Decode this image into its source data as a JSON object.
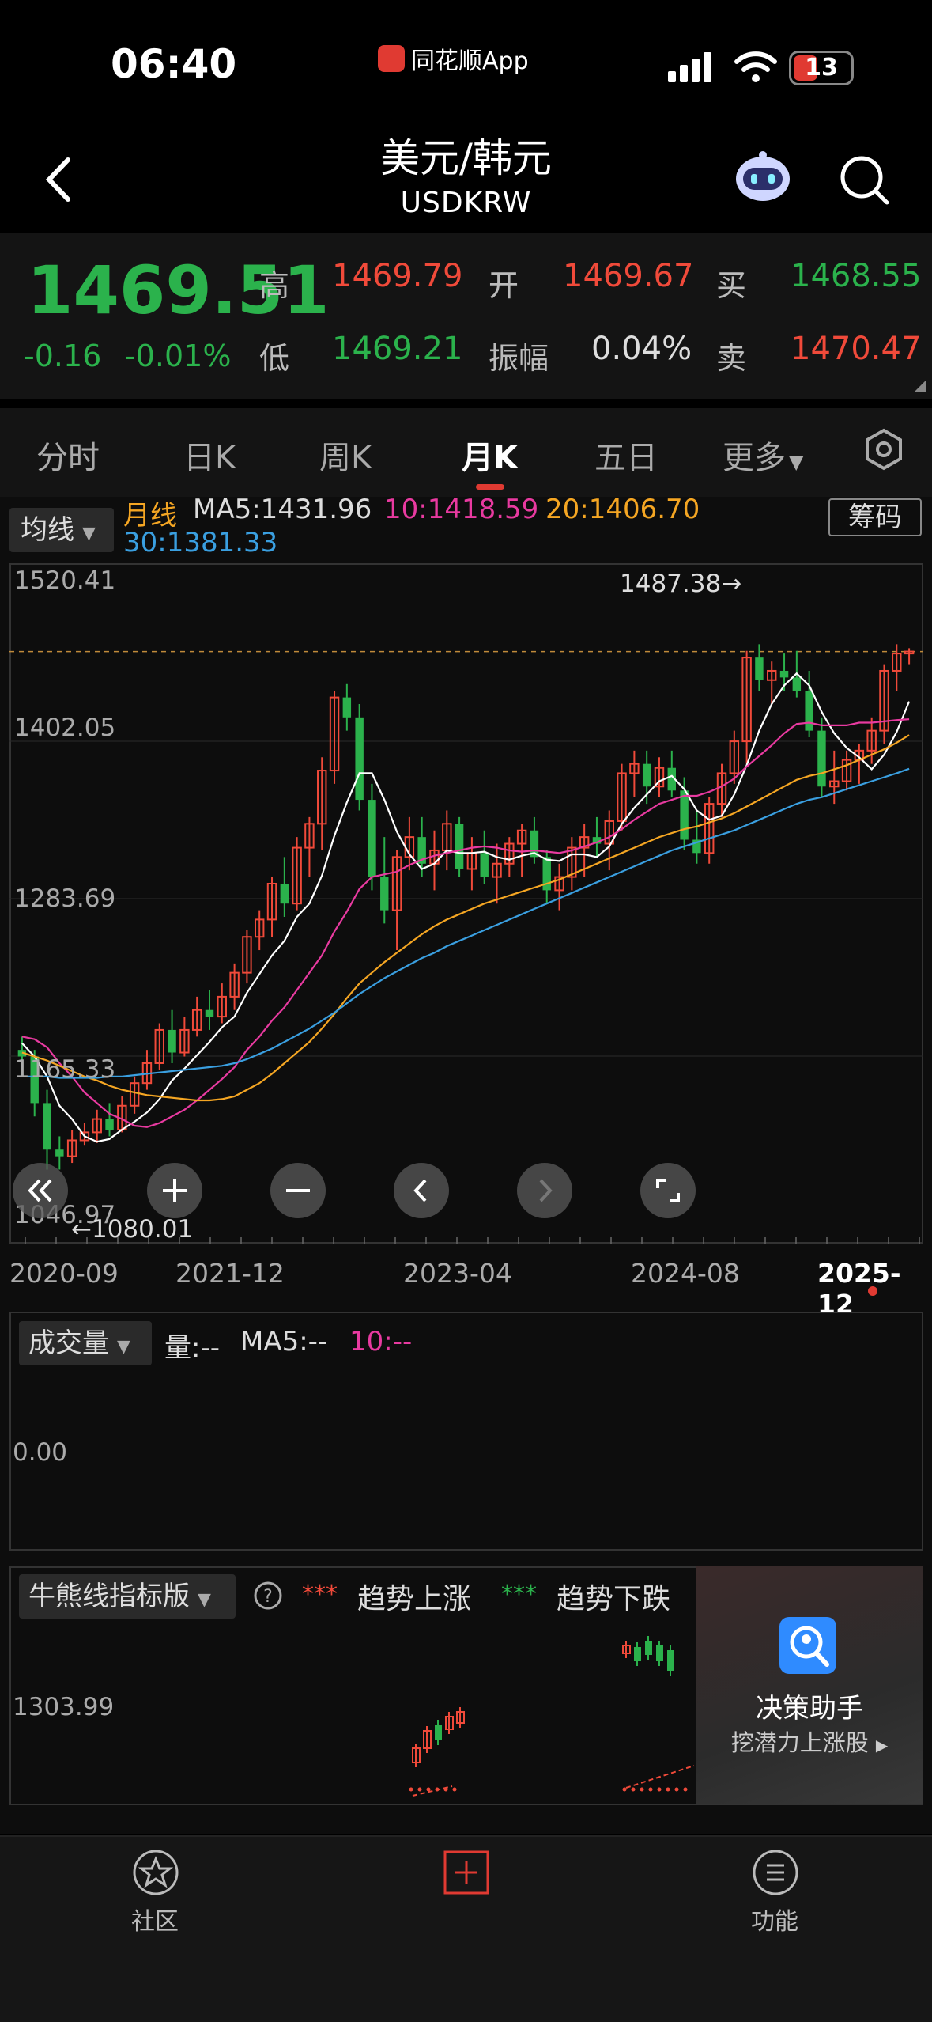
{
  "status": {
    "time": "06:40",
    "app": "同花顺App",
    "battery": "13"
  },
  "header": {
    "title": "美元/韩元",
    "subtitle": "USDKRW"
  },
  "quote": {
    "price": "1469.51",
    "change": "-0.16",
    "change_pct": "-0.01%",
    "high_label": "高",
    "high": "1469.79",
    "open_label": "开",
    "open": "1469.67",
    "buy_label": "买",
    "buy": "1468.55",
    "low_label": "低",
    "low": "1469.21",
    "amp_label": "振幅",
    "amp": "0.04%",
    "sell_label": "卖",
    "sell": "1470.47",
    "up_color": "#f04a3a",
    "down_color": "#2bb24c"
  },
  "tabs": [
    "分时",
    "日K",
    "周K",
    "月K",
    "五日",
    "更多"
  ],
  "active_tab": "月K",
  "ma": {
    "toggle": "均线",
    "period": "月线",
    "ma5": "MA5:1431.96",
    "ma10": "10:1418.59",
    "ma20": "20:1406.70",
    "ma30": "30:1381.33",
    "chips": "筹码",
    "colors": {
      "ma5": "#ffffff",
      "ma10": "#e83aa0",
      "ma20": "#f5a623",
      "ma30": "#3a9fe0"
    }
  },
  "chart_data": {
    "type": "candlestick",
    "period": "monthly",
    "y_ticks": [
      "1520.41",
      "1402.05",
      "1283.69",
      "1165.33",
      "1046.97"
    ],
    "ylim": [
      1046.97,
      1520.41
    ],
    "x_ticks": [
      "2020-09",
      "2021-12",
      "2023-04",
      "2024-08",
      "2025-12"
    ],
    "max_annotation": "1487.38→",
    "min_annotation": "←1080.01",
    "last_close": 1469.51,
    "ohlc": [
      [
        1170,
        1180,
        1150,
        1165
      ],
      [
        1165,
        1170,
        1120,
        1130
      ],
      [
        1130,
        1140,
        1080,
        1095
      ],
      [
        1095,
        1105,
        1080,
        1090
      ],
      [
        1090,
        1110,
        1085,
        1102
      ],
      [
        1102,
        1115,
        1098,
        1108
      ],
      [
        1108,
        1125,
        1100,
        1118
      ],
      [
        1118,
        1130,
        1105,
        1110
      ],
      [
        1110,
        1135,
        1108,
        1128
      ],
      [
        1128,
        1150,
        1122,
        1145
      ],
      [
        1145,
        1170,
        1140,
        1160
      ],
      [
        1160,
        1190,
        1155,
        1185
      ],
      [
        1185,
        1200,
        1160,
        1168
      ],
      [
        1168,
        1195,
        1165,
        1185
      ],
      [
        1185,
        1210,
        1180,
        1200
      ],
      [
        1200,
        1215,
        1185,
        1195
      ],
      [
        1195,
        1220,
        1190,
        1210
      ],
      [
        1210,
        1235,
        1200,
        1228
      ],
      [
        1228,
        1260,
        1220,
        1255
      ],
      [
        1255,
        1275,
        1245,
        1268
      ],
      [
        1268,
        1300,
        1255,
        1295
      ],
      [
        1295,
        1315,
        1270,
        1280
      ],
      [
        1280,
        1330,
        1275,
        1322
      ],
      [
        1322,
        1345,
        1300,
        1340
      ],
      [
        1340,
        1390,
        1320,
        1380
      ],
      [
        1380,
        1440,
        1370,
        1435
      ],
      [
        1435,
        1445,
        1410,
        1420
      ],
      [
        1420,
        1430,
        1350,
        1358
      ],
      [
        1358,
        1370,
        1290,
        1300
      ],
      [
        1300,
        1330,
        1265,
        1275
      ],
      [
        1275,
        1320,
        1245,
        1315
      ],
      [
        1315,
        1345,
        1305,
        1330
      ],
      [
        1330,
        1345,
        1300,
        1310
      ],
      [
        1310,
        1335,
        1290,
        1320
      ],
      [
        1320,
        1350,
        1305,
        1340
      ],
      [
        1340,
        1345,
        1300,
        1306
      ],
      [
        1306,
        1330,
        1290,
        1318
      ],
      [
        1318,
        1335,
        1295,
        1300
      ],
      [
        1300,
        1325,
        1280,
        1310
      ],
      [
        1310,
        1330,
        1300,
        1325
      ],
      [
        1325,
        1340,
        1300,
        1335
      ],
      [
        1335,
        1345,
        1310,
        1315
      ],
      [
        1315,
        1320,
        1280,
        1290
      ],
      [
        1290,
        1310,
        1275,
        1300
      ],
      [
        1300,
        1330,
        1290,
        1322
      ],
      [
        1322,
        1340,
        1300,
        1330
      ],
      [
        1330,
        1345,
        1315,
        1325
      ],
      [
        1325,
        1350,
        1305,
        1342
      ],
      [
        1342,
        1385,
        1335,
        1378
      ],
      [
        1378,
        1395,
        1360,
        1385
      ],
      [
        1385,
        1395,
        1355,
        1368
      ],
      [
        1368,
        1390,
        1360,
        1382
      ],
      [
        1382,
        1395,
        1360,
        1365
      ],
      [
        1365,
        1375,
        1320,
        1328
      ],
      [
        1328,
        1350,
        1310,
        1318
      ],
      [
        1318,
        1360,
        1310,
        1355
      ],
      [
        1355,
        1385,
        1345,
        1378
      ],
      [
        1378,
        1410,
        1370,
        1402
      ],
      [
        1402,
        1470,
        1385,
        1465
      ],
      [
        1465,
        1475,
        1440,
        1448
      ],
      [
        1448,
        1462,
        1430,
        1455
      ],
      [
        1455,
        1468,
        1440,
        1450
      ],
      [
        1450,
        1470,
        1435,
        1440
      ],
      [
        1440,
        1455,
        1405,
        1410
      ],
      [
        1410,
        1420,
        1360,
        1368
      ],
      [
        1368,
        1395,
        1355,
        1372
      ],
      [
        1372,
        1395,
        1365,
        1388
      ],
      [
        1388,
        1400,
        1370,
        1395
      ],
      [
        1395,
        1420,
        1385,
        1410
      ],
      [
        1410,
        1460,
        1400,
        1455
      ],
      [
        1455,
        1475,
        1440,
        1468
      ],
      [
        1468,
        1472,
        1460,
        1469.51
      ]
    ],
    "ma_lines": {
      "ma5": [
        1175,
        1165,
        1150,
        1128,
        1118,
        1105,
        1101,
        1103,
        1110,
        1116,
        1123,
        1133,
        1147,
        1156,
        1166,
        1176,
        1187,
        1195,
        1213,
        1227,
        1241,
        1252,
        1270,
        1280,
        1301,
        1331,
        1356,
        1378,
        1378,
        1358,
        1334,
        1317,
        1306,
        1310,
        1320,
        1318,
        1318,
        1319,
        1315,
        1313,
        1316,
        1318,
        1313,
        1312,
        1317,
        1317,
        1315,
        1323,
        1340,
        1352,
        1362,
        1372,
        1376,
        1366,
        1350,
        1343,
        1346,
        1362,
        1384,
        1410,
        1430,
        1444,
        1453,
        1444,
        1424,
        1408,
        1397,
        1390,
        1381,
        1392,
        1409,
        1431.96
      ],
      "ma10": [
        1180,
        1178,
        1172,
        1160,
        1150,
        1138,
        1130,
        1122,
        1118,
        1113,
        1112,
        1115,
        1120,
        1125,
        1132,
        1140,
        1148,
        1157,
        1170,
        1180,
        1192,
        1202,
        1215,
        1228,
        1241,
        1259,
        1274,
        1291,
        1300,
        1302,
        1304,
        1309,
        1313,
        1316,
        1318,
        1320,
        1322,
        1323,
        1322,
        1320,
        1319,
        1320,
        1319,
        1318,
        1320,
        1323,
        1326,
        1330,
        1336,
        1343,
        1349,
        1355,
        1358,
        1361,
        1361,
        1364,
        1368,
        1374,
        1383,
        1391,
        1399,
        1408,
        1415,
        1416,
        1414,
        1414,
        1414,
        1416,
        1416,
        1417,
        1418,
        1418.59
      ],
      "ma20": [
        1168,
        1165,
        1162,
        1158,
        1154,
        1150,
        1147,
        1143,
        1140,
        1138,
        1136,
        1135,
        1134,
        1133,
        1132,
        1132,
        1133,
        1135,
        1140,
        1145,
        1152,
        1160,
        1168,
        1176,
        1186,
        1197,
        1209,
        1220,
        1228,
        1236,
        1243,
        1250,
        1257,
        1263,
        1268,
        1272,
        1276,
        1280,
        1283,
        1286,
        1289,
        1292,
        1295,
        1298,
        1302,
        1306,
        1310,
        1314,
        1318,
        1322,
        1326,
        1330,
        1333,
        1336,
        1338,
        1341,
        1344,
        1348,
        1353,
        1358,
        1363,
        1368,
        1373,
        1376,
        1378,
        1381,
        1384,
        1388,
        1392,
        1396,
        1401,
        1406.7
      ],
      "ma30": [
        1150,
        1150,
        1150,
        1149,
        1149,
        1149,
        1149,
        1150,
        1150,
        1151,
        1152,
        1153,
        1154,
        1155,
        1156,
        1157,
        1158,
        1160,
        1163,
        1167,
        1171,
        1176,
        1181,
        1186,
        1192,
        1198,
        1205,
        1212,
        1218,
        1224,
        1229,
        1234,
        1239,
        1243,
        1248,
        1252,
        1256,
        1260,
        1264,
        1268,
        1272,
        1276,
        1280,
        1284,
        1288,
        1292,
        1296,
        1300,
        1304,
        1308,
        1312,
        1316,
        1320,
        1323,
        1326,
        1329,
        1332,
        1335,
        1339,
        1343,
        1347,
        1351,
        1355,
        1358,
        1360,
        1363,
        1366,
        1369,
        1372,
        1375,
        1378,
        1381.33
      ]
    }
  },
  "volume": {
    "toggle": "成交量",
    "vol": "量:--",
    "ma5": "MA5:--",
    "ma10": "10:--",
    "axis": "0.00"
  },
  "indicator": {
    "toggle": "牛熊线指标版",
    "up_label": "趋势上涨",
    "down_label": "趋势下跌",
    "axis": "1303.99"
  },
  "assistant": {
    "title": "决策助手",
    "subtitle": "挖潜力上涨股"
  },
  "bottom_nav": {
    "community": "社区",
    "center": "",
    "functions": "功能"
  }
}
